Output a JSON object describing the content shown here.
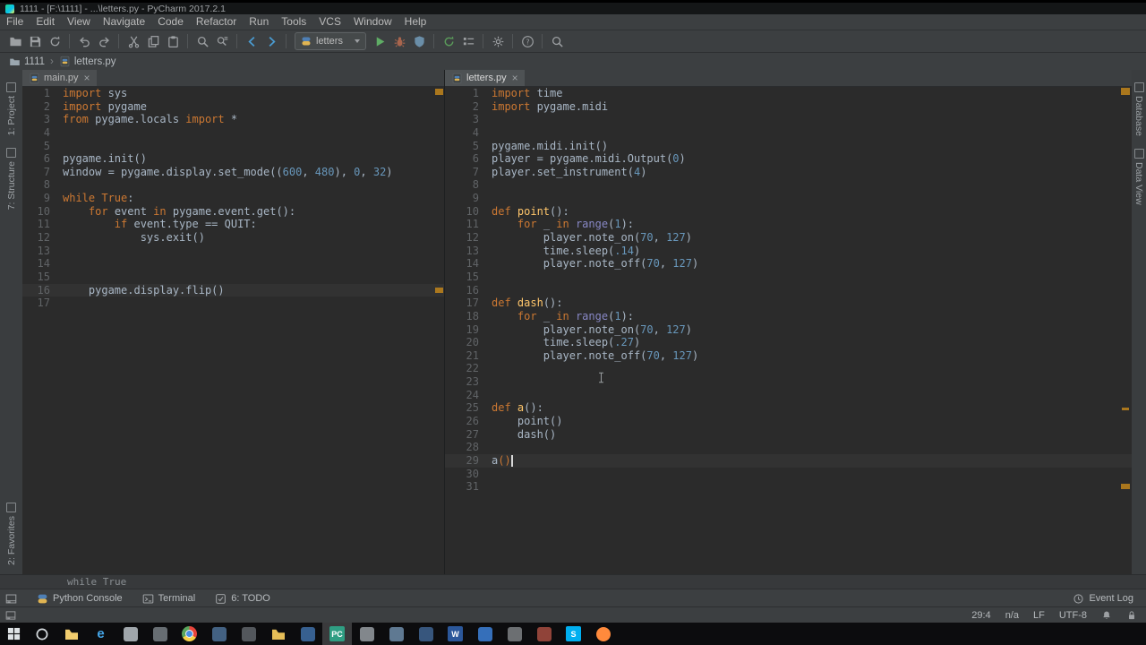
{
  "titlebar": {
    "title": "1111 - [F:\\1111] - ...\\letters.py - PyCharm 2017.2.1"
  },
  "menubar": [
    "File",
    "Edit",
    "View",
    "Navigate",
    "Code",
    "Refactor",
    "Run",
    "Tools",
    "VCS",
    "Window",
    "Help"
  ],
  "toolbar": {
    "run_config": "letters",
    "groups": [
      {
        "items": [
          {
            "icon": "open-folder"
          },
          {
            "icon": "save-all"
          },
          {
            "icon": "sync"
          }
        ]
      },
      {
        "items": [
          {
            "icon": "undo"
          },
          {
            "icon": "redo"
          }
        ]
      },
      {
        "items": [
          {
            "icon": "cut"
          },
          {
            "icon": "copy"
          },
          {
            "icon": "paste"
          }
        ]
      },
      {
        "items": [
          {
            "icon": "find"
          },
          {
            "icon": "replace"
          }
        ]
      },
      {
        "items": [
          {
            "icon": "back"
          },
          {
            "icon": "forward"
          }
        ]
      },
      {
        "items": [
          {
            "type": "combo"
          },
          {
            "icon": "run"
          },
          {
            "icon": "debug"
          },
          {
            "icon": "coverage"
          }
        ]
      },
      {
        "items": [
          {
            "icon": "rerun"
          },
          {
            "icon": "edit-configs"
          }
        ]
      },
      {
        "items": [
          {
            "icon": "settings"
          }
        ]
      },
      {
        "items": [
          {
            "icon": "help"
          }
        ]
      },
      {
        "items": [
          {
            "icon": "search-everywhere"
          }
        ]
      }
    ]
  },
  "breadcrumb": [
    {
      "icon": "folder-small",
      "label": "1111"
    },
    {
      "icon": "pyfile",
      "label": "letters.py"
    }
  ],
  "tool_buttons": {
    "left_top": [
      "1: Project",
      "7: Structure"
    ],
    "left_bottom": [
      "2: Favorites"
    ],
    "right_top": [
      "Database",
      "Data View"
    ]
  },
  "editors": [
    {
      "tab": "main.py",
      "active_line": 16,
      "lines": [
        [
          [
            "k",
            "import"
          ],
          [
            "p",
            " sys"
          ]
        ],
        [
          [
            "k",
            "import"
          ],
          [
            "p",
            " pygame"
          ]
        ],
        [
          [
            "k",
            "from"
          ],
          [
            "p",
            " pygame.locals "
          ],
          [
            "k",
            "import"
          ],
          [
            "p",
            " *"
          ]
        ],
        [],
        [],
        [
          [
            "p",
            "pygame.init()"
          ]
        ],
        [
          [
            "p",
            "window = pygame.display.set_mode(("
          ],
          [
            "n",
            "600"
          ],
          [
            "p",
            ", "
          ],
          [
            "n",
            "480"
          ],
          [
            "p",
            "), "
          ],
          [
            "n",
            "0"
          ],
          [
            "p",
            ", "
          ],
          [
            "n",
            "32"
          ],
          [
            "p",
            ")"
          ]
        ],
        [],
        [
          [
            "k",
            "while True"
          ],
          [
            "p",
            ":"
          ]
        ],
        [
          [
            "p",
            "    "
          ],
          [
            "k",
            "for"
          ],
          [
            "p",
            " event "
          ],
          [
            "k",
            "in"
          ],
          [
            "p",
            " pygame.event.get():"
          ]
        ],
        [
          [
            "p",
            "        "
          ],
          [
            "k",
            "if"
          ],
          [
            "p",
            " event.type == QUIT:"
          ]
        ],
        [
          [
            "p",
            "            sys.exit()"
          ]
        ],
        [],
        [],
        [],
        [
          [
            "p",
            "    pygame.display.flip()"
          ]
        ],
        []
      ]
    },
    {
      "tab": "letters.py",
      "active_line": 29,
      "cursor": {
        "line": 29,
        "col": 4
      },
      "lines": [
        [
          [
            "k",
            "import"
          ],
          [
            "p",
            " time"
          ]
        ],
        [
          [
            "k",
            "import"
          ],
          [
            "p",
            " pygame.midi"
          ]
        ],
        [],
        [],
        [
          [
            "p",
            "pygame.midi.init()"
          ]
        ],
        [
          [
            "p",
            "player = pygame.midi.Output("
          ],
          [
            "n",
            "0"
          ],
          [
            "p",
            ")"
          ]
        ],
        [
          [
            "p",
            "player.set_instrument("
          ],
          [
            "n",
            "4"
          ],
          [
            "p",
            ")"
          ]
        ],
        [],
        [],
        [
          [
            "k",
            "def"
          ],
          [
            "f",
            " point"
          ],
          [
            "p",
            "():"
          ]
        ],
        [
          [
            "p",
            "    "
          ],
          [
            "k",
            "for"
          ],
          [
            "p",
            " _ "
          ],
          [
            "k",
            "in"
          ],
          [
            "b",
            " range"
          ],
          [
            "p",
            "("
          ],
          [
            "n",
            "1"
          ],
          [
            "p",
            "):"
          ]
        ],
        [
          [
            "p",
            "        player.note_on("
          ],
          [
            "n",
            "70"
          ],
          [
            "p",
            ", "
          ],
          [
            "n",
            "127"
          ],
          [
            "p",
            ")"
          ]
        ],
        [
          [
            "p",
            "        time.sleep("
          ],
          [
            "n",
            ".14"
          ],
          [
            "p",
            ")"
          ]
        ],
        [
          [
            "p",
            "        player.note_off("
          ],
          [
            "n",
            "70"
          ],
          [
            "p",
            ", "
          ],
          [
            "n",
            "127"
          ],
          [
            "p",
            ")"
          ]
        ],
        [],
        [],
        [
          [
            "k",
            "def"
          ],
          [
            "f",
            " dash"
          ],
          [
            "p",
            "():"
          ]
        ],
        [
          [
            "p",
            "    "
          ],
          [
            "k",
            "for"
          ],
          [
            "p",
            " _ "
          ],
          [
            "k",
            "in"
          ],
          [
            "b",
            " range"
          ],
          [
            "p",
            "("
          ],
          [
            "n",
            "1"
          ],
          [
            "p",
            "):"
          ]
        ],
        [
          [
            "p",
            "        player.note_on("
          ],
          [
            "n",
            "70"
          ],
          [
            "p",
            ", "
          ],
          [
            "n",
            "127"
          ],
          [
            "p",
            ")"
          ]
        ],
        [
          [
            "p",
            "        time.sleep("
          ],
          [
            "n",
            ".27"
          ],
          [
            "p",
            ")"
          ]
        ],
        [
          [
            "p",
            "        player.note_off("
          ],
          [
            "n",
            "70"
          ],
          [
            "p",
            ", "
          ],
          [
            "n",
            "127"
          ],
          [
            "p",
            ")"
          ]
        ],
        [],
        [],
        [],
        [
          [
            "k",
            "def"
          ],
          [
            "f",
            " a"
          ],
          [
            "p",
            "():"
          ]
        ],
        [
          [
            "p",
            "    point()"
          ]
        ],
        [
          [
            "p",
            "    dash()"
          ]
        ],
        [],
        [
          [
            "p",
            "a"
          ],
          [
            "k",
            "()"
          ]
        ],
        [],
        []
      ]
    }
  ],
  "context_bar": "while True",
  "bottom_bar": {
    "left": [
      {
        "icon": "python",
        "label": "Python Console"
      },
      {
        "icon": "terminal",
        "label": "Terminal"
      },
      {
        "icon": "todo",
        "label": "6: TODO"
      }
    ],
    "right": [
      {
        "icon": "clock",
        "label": "Event Log"
      }
    ]
  },
  "statusbar": {
    "items": [
      "29:4",
      "n/a",
      "LF",
      "UTF-8"
    ]
  },
  "taskbar": {
    "apps": [
      {
        "name": "start",
        "kind": "start"
      },
      {
        "name": "search",
        "kind": "ring"
      },
      {
        "name": "file-explorer",
        "kind": "folder",
        "color": "#f2cd6e"
      },
      {
        "name": "edge",
        "kind": "letter-plain",
        "letter": "e",
        "color": "#45a6e8"
      },
      {
        "name": "store",
        "kind": "square",
        "color": "#aeb4b9"
      },
      {
        "name": "app-1",
        "kind": "square",
        "color": "#70767b"
      },
      {
        "name": "chrome",
        "kind": "chrome"
      },
      {
        "name": "app-2",
        "kind": "square",
        "color": "#49698c"
      },
      {
        "name": "app-3",
        "kind": "square",
        "color": "#5a5e63"
      },
      {
        "name": "folder-2",
        "kind": "folder",
        "color": "#e5bd57"
      },
      {
        "name": "app-4",
        "kind": "square",
        "color": "#3c689b"
      },
      {
        "name": "pycharm",
        "kind": "letter",
        "letter": "PC",
        "color": "#2f9e83",
        "active": true
      },
      {
        "name": "app-5",
        "kind": "square",
        "color": "#8d9297"
      },
      {
        "name": "app-6",
        "kind": "square",
        "color": "#67839d"
      },
      {
        "name": "app-7",
        "kind": "square",
        "color": "#3c5d87"
      },
      {
        "name": "word",
        "kind": "letter",
        "letter": "W",
        "color": "#2b579a"
      },
      {
        "name": "app-8",
        "kind": "square",
        "color": "#3a78c9"
      },
      {
        "name": "app-9",
        "kind": "square",
        "color": "#75787b"
      },
      {
        "name": "app-10",
        "kind": "square",
        "color": "#9c493d"
      },
      {
        "name": "skype",
        "kind": "letter",
        "letter": "S",
        "color": "#00aff0"
      },
      {
        "name": "firefox",
        "kind": "circle",
        "color": "#ff8a3c"
      }
    ]
  },
  "colors": {
    "keyword": "#cc7832",
    "number": "#6897bb",
    "function_name": "#ffc66b",
    "builtin": "#8888c6",
    "editor_text": "#a9b7c6",
    "editor_bg": "#2b2b2b",
    "panel_bg": "#3c3f41",
    "active_line_bg": "#323232",
    "line_number": "#606366",
    "run_green": "#5fad65",
    "stripe_mark": "#b8801c"
  }
}
